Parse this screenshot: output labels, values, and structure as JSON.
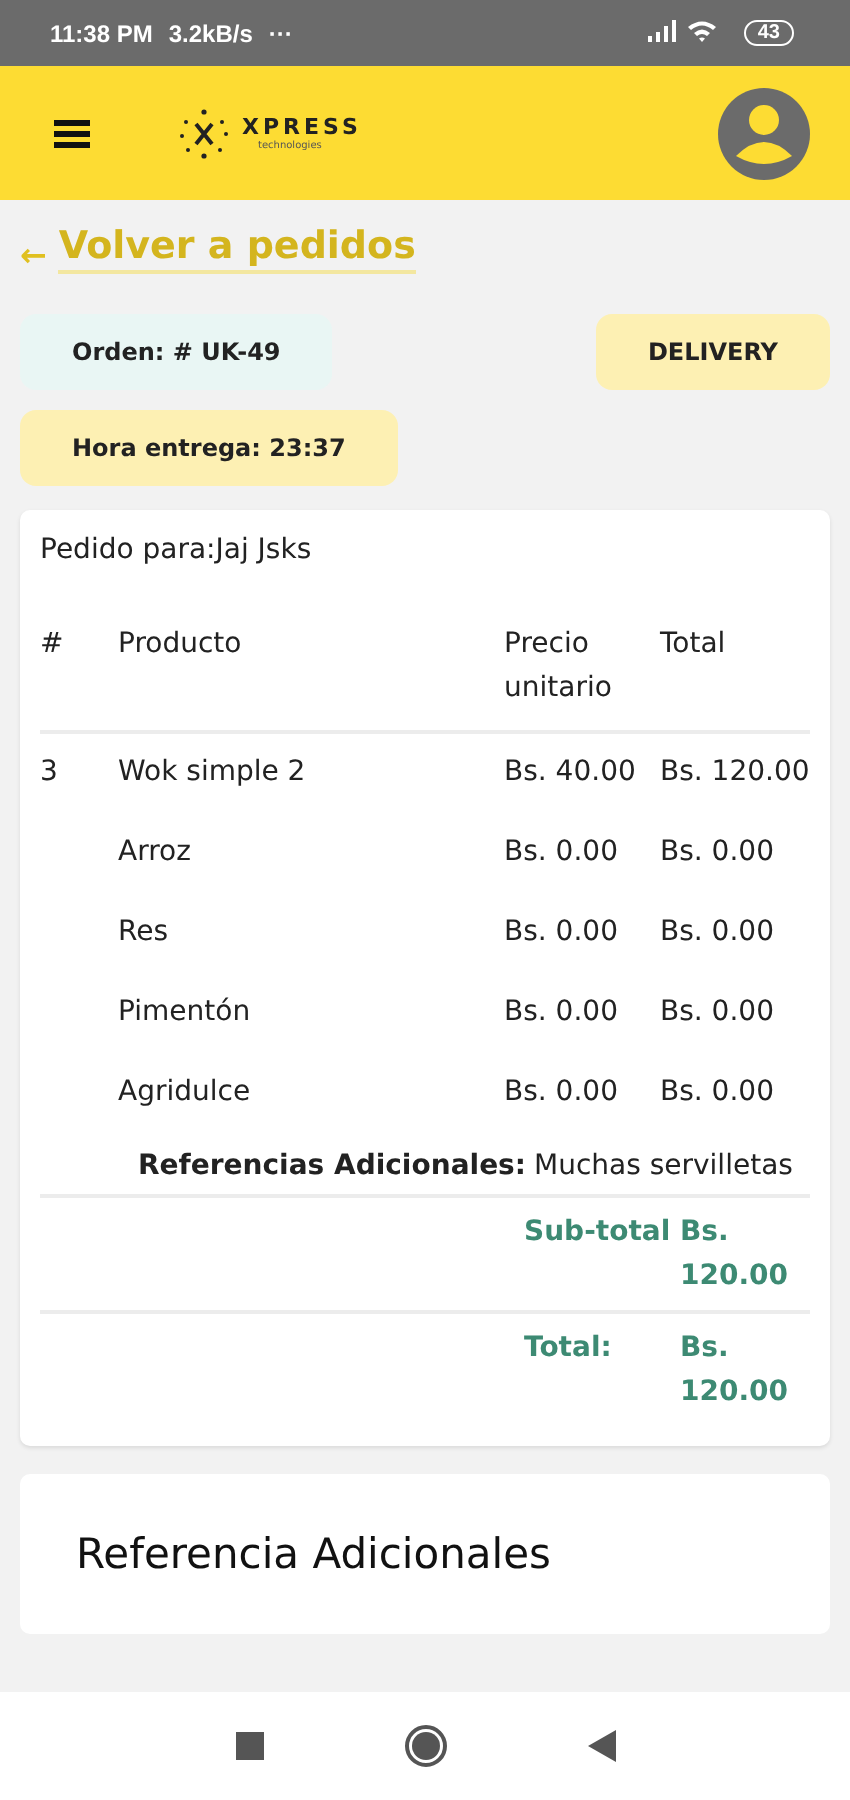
{
  "status_bar": {
    "time": "11:38 PM",
    "speed": "3.2kB/s",
    "more": "···",
    "battery": "43"
  },
  "header": {
    "logo_name": "XPRESS",
    "logo_sub": "technologies"
  },
  "back_link": {
    "arrow": "←",
    "label": "Volver a pedidos"
  },
  "order": {
    "number": "Orden: # UK-49",
    "type": "DELIVERY",
    "delivery_time": "Hora entrega: 23:37"
  },
  "details": {
    "customer": "Pedido para:Jaj Jsks",
    "columns": [
      "#",
      "Producto",
      "Precio unitario",
      "Total"
    ],
    "rows": [
      {
        "kind": "main",
        "qty": "3",
        "name": "Wok simple 2",
        "price": "Bs. 40.00",
        "total": "Bs. 120.00"
      },
      {
        "kind": "extra",
        "name": "Arroz",
        "price": "Bs. 0.00",
        "total": "Bs. 0.00"
      },
      {
        "kind": "extra",
        "name": "Res",
        "price": "Bs. 0.00",
        "total": "Bs. 0.00"
      },
      {
        "kind": "extra",
        "name": "Pimentón",
        "price": "Bs. 0.00",
        "total": "Bs. 0.00"
      },
      {
        "kind": "extra",
        "name": "Agridulce",
        "price": "Bs. 0.00",
        "total": "Bs. 0.00"
      }
    ],
    "notes": {
      "label": "Referencias Adicionales:",
      "value": "Muchas servilletas"
    },
    "subtotal": {
      "label": "Sub-total",
      "value": "Bs. 120.00"
    },
    "total": {
      "label": "Total:",
      "value": "Bs. 120.00"
    }
  },
  "additional_card": {
    "title": "Referencia Adicionales"
  }
}
